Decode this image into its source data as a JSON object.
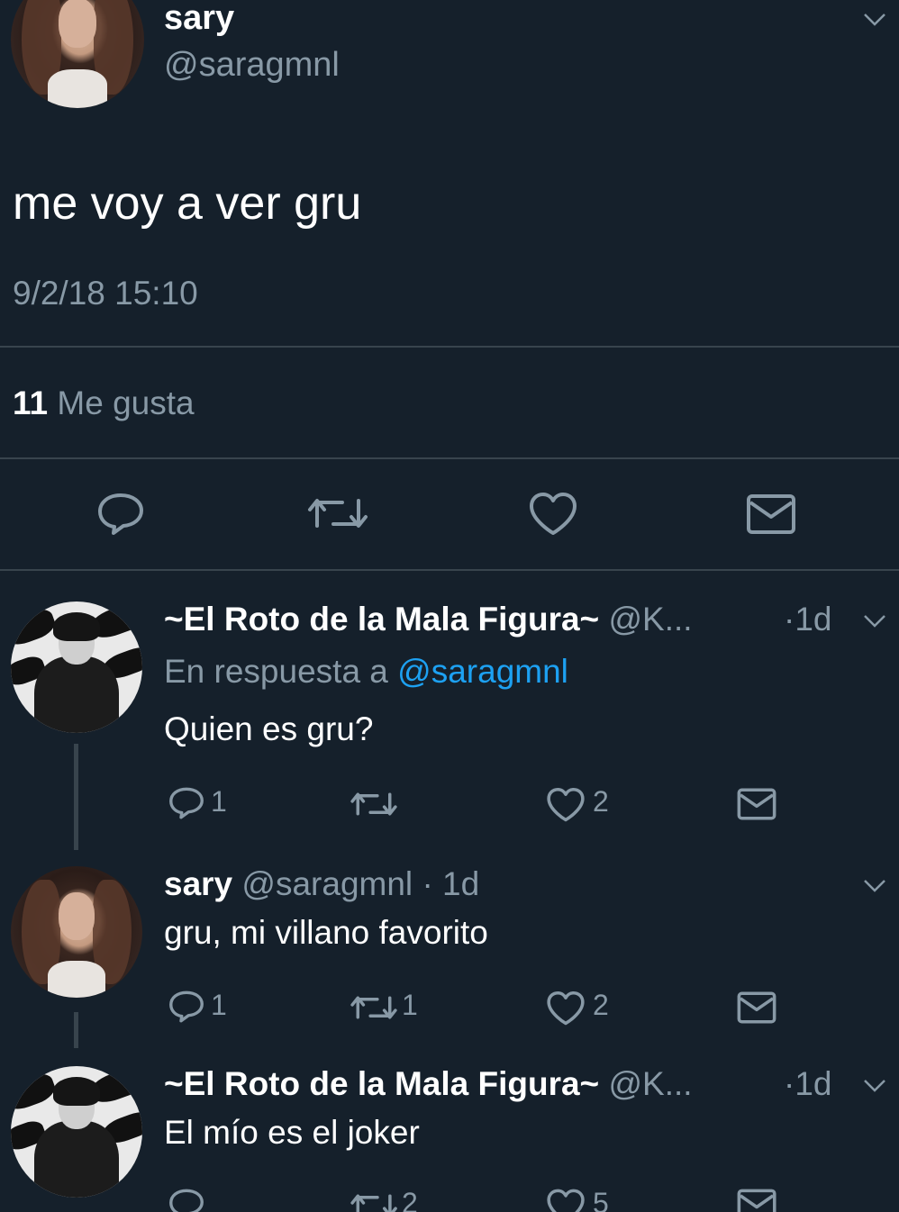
{
  "main_tweet": {
    "display_name": "sary",
    "handle": "@saragmnl",
    "text": "me voy a ver gru",
    "timestamp": "9/2/18 15:10",
    "likes_count": "11",
    "likes_label": "Me gusta",
    "icons": [
      "chevron-down-icon",
      "reply-icon",
      "retweet-icon",
      "like-icon",
      "dm-icon"
    ]
  },
  "replies": [
    {
      "display_name": "~El Roto de la Mala Figura~",
      "handle": "@K...",
      "time": "·1d",
      "reply_prefix": "En respuesta a",
      "reply_to": "@saragmnl",
      "text": "Quien es gru?",
      "reply_count": "1",
      "retweet_count": "",
      "like_count": "2"
    },
    {
      "display_name": "sary",
      "handle": "@saragmnl",
      "time": "· 1d",
      "text": "gru, mi villano favorito",
      "reply_count": "1",
      "retweet_count": "1",
      "like_count": "2"
    },
    {
      "display_name": "~El Roto de la Mala Figura~",
      "handle": "@K...",
      "time": "·1d",
      "text": "El mío es el joker",
      "reply_count": "",
      "retweet_count": "2",
      "like_count": "5"
    }
  ],
  "colors": {
    "background": "#15202b",
    "muted": "#8899a6",
    "link": "#1da1f2",
    "divider": "#38444d"
  }
}
